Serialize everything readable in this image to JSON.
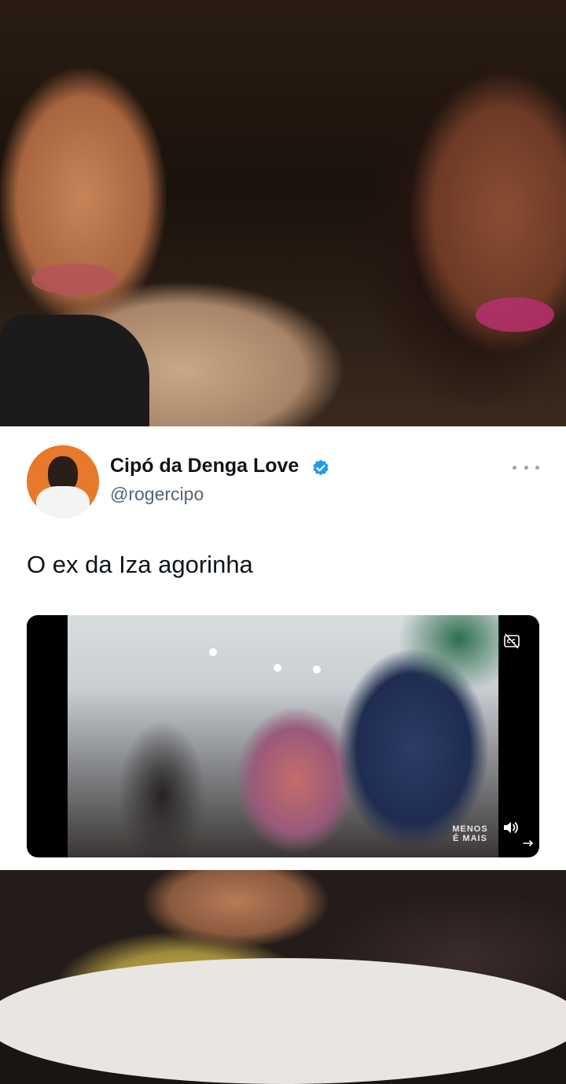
{
  "tweet": {
    "display_name": "Cipó da Denga Love",
    "handle": "@rogercipo",
    "text": "O ex da Iza agorinha",
    "verified": true
  },
  "video": {
    "watermark_line1": "MENOS",
    "watermark_line2": "É MAIS",
    "icons": [
      "closed-captions-icon",
      "sound-on-icon",
      "expand-icon"
    ]
  },
  "colors": {
    "card_background": "#ffffff",
    "name_text": "#0f1419",
    "handle_text": "#536471",
    "verified_badge": "#1d9bf0",
    "avatar_background": "#e8782a"
  }
}
